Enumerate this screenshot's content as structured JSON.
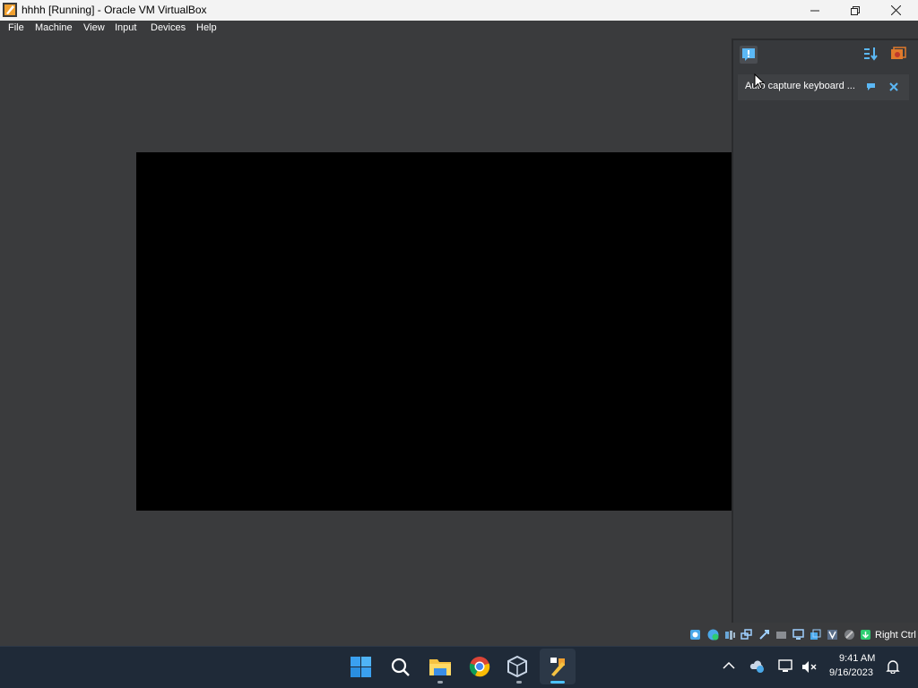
{
  "window": {
    "title": "hhhh [Running] - Oracle VM VirtualBox",
    "controls": [
      "minimize",
      "maximize",
      "close"
    ]
  },
  "menu": {
    "items": [
      "File",
      "Machine",
      "View",
      "Input",
      "Devices",
      "Help"
    ]
  },
  "notification_panel": {
    "message": "Auto capture keyboard ...",
    "icons": [
      "notification-center-icon",
      "sort-icon",
      "toggle-panel-icon",
      "keep-icon",
      "close-icon"
    ]
  },
  "statusbar": {
    "host_key": "Right Ctrl",
    "icons": [
      "hard-disk-icon",
      "optical-drive-icon",
      "audio-icon",
      "network-icon",
      "usb-icon",
      "shared-folders-icon",
      "display-icon",
      "recording-icon",
      "vt-x-icon",
      "mouse-integration-icon",
      "keyboard-icon"
    ]
  },
  "taskbar": {
    "apps": [
      "start-icon",
      "search-icon",
      "file-explorer-icon",
      "chrome-icon",
      "virtualbox-icon",
      "vm-window-icon"
    ],
    "time": "9:41 AM",
    "date": "9/16/2023"
  },
  "colors": {
    "background": "#3a3b3d",
    "vm_screen": "#000000",
    "taskbar": "#1f2a38",
    "accent": "#4cc2ff"
  }
}
